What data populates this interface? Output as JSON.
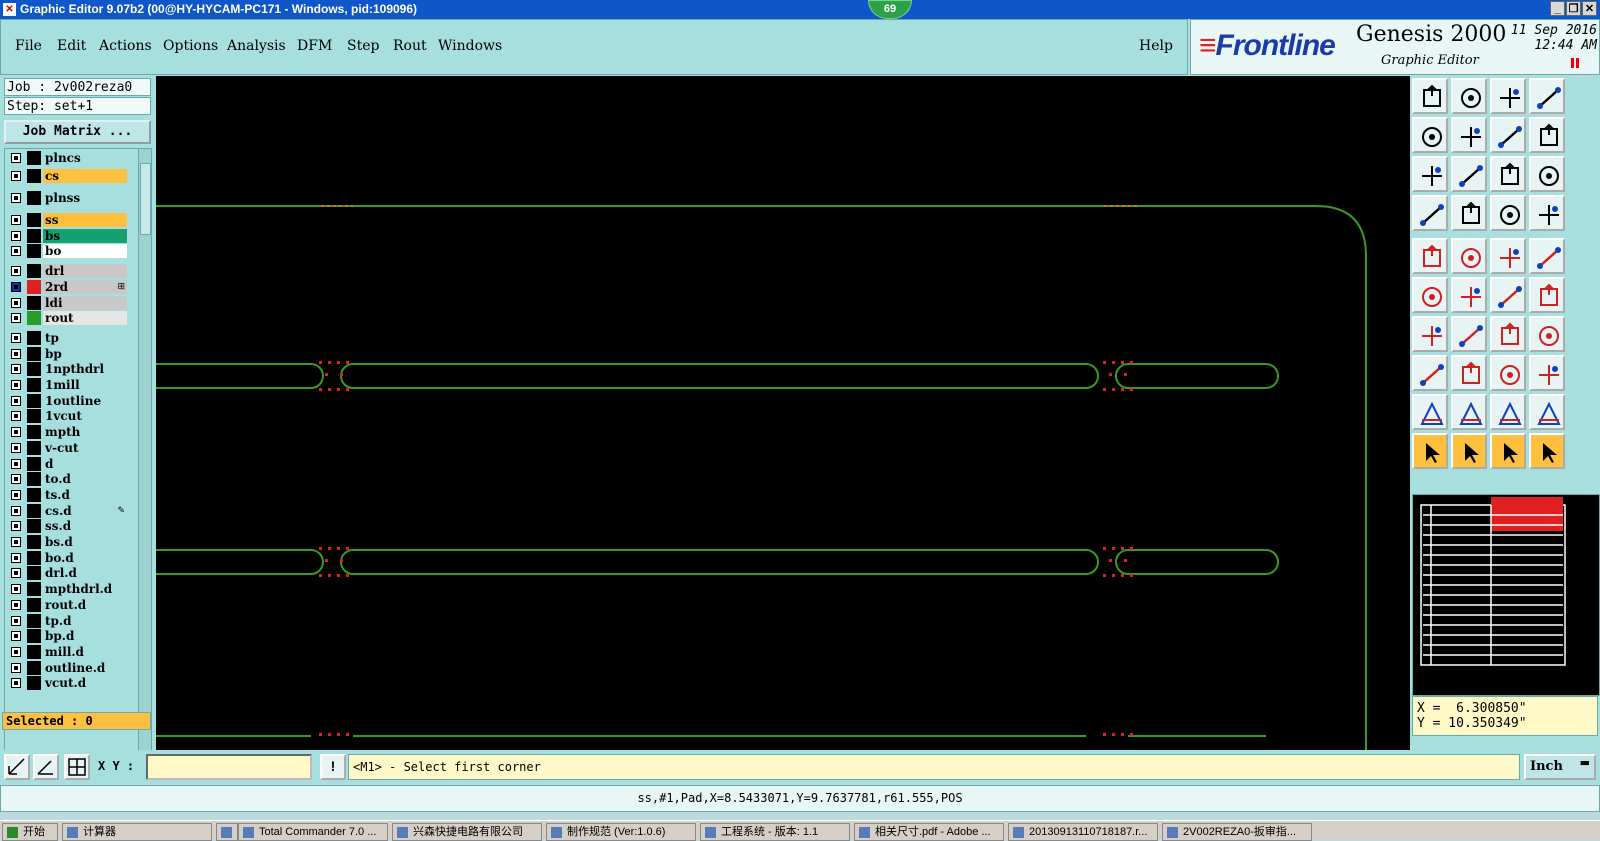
{
  "window": {
    "title": "Graphic Editor 9.07b2 (00@HY-HYCAM-PC171 - Windows, pid:109096)",
    "badge": "69",
    "min_glyph": "_",
    "max_glyph": "❐",
    "close_glyph": "✕"
  },
  "menu": [
    "File",
    "Edit",
    "Actions",
    "Options",
    "Analysis",
    "DFM",
    "Step",
    "Rout",
    "Windows"
  ],
  "help_label": "Help",
  "brand": {
    "logo": "Frontline",
    "title": "Genesis 2000",
    "subtitle": "Graphic Editor",
    "date": "11 Sep 2016",
    "time": "12:44 AM"
  },
  "job": {
    "job_line": "Job : 2v002reza0",
    "step_line": "Step: set+1",
    "matrix_button": "Job Matrix ..."
  },
  "layers": [
    {
      "name": "plncs",
      "color": "#a7dede",
      "swatch": "#000000"
    },
    {
      "name": "cs",
      "color": "#ffbf3f",
      "swatch": "#000000"
    },
    {
      "name": "plnss",
      "color": "#a7dede",
      "swatch": "#000000"
    },
    {
      "name": "ss",
      "color": "#ffbf3f",
      "swatch": "#000000"
    },
    {
      "name": "bs",
      "color": "#14a070",
      "swatch": "#000000"
    },
    {
      "name": "bo",
      "color": "#ffffff",
      "swatch": "#000000"
    },
    {
      "name": "drl",
      "color": "#c8c8c8",
      "swatch": "#000000"
    },
    {
      "name": "2rd",
      "color": "#c8c8c8",
      "swatch": "#e02020",
      "marker": "⊞",
      "selected": true
    },
    {
      "name": "ldi",
      "color": "#c8c8c8",
      "swatch": "#000000"
    },
    {
      "name": "rout",
      "color": "#e6e6e6",
      "swatch": "#2a9a2a"
    },
    {
      "name": "tp",
      "color": "#a7dede",
      "swatch": "#000000"
    },
    {
      "name": "bp",
      "color": "#a7dede",
      "swatch": "#000000"
    },
    {
      "name": "1npthdrl",
      "color": "#a7dede",
      "swatch": "#000000"
    },
    {
      "name": "1mill",
      "color": "#a7dede",
      "swatch": "#000000"
    },
    {
      "name": "1outline",
      "color": "#a7dede",
      "swatch": "#000000"
    },
    {
      "name": "1vcut",
      "color": "#a7dede",
      "swatch": "#000000"
    },
    {
      "name": "mpth",
      "color": "#a7dede",
      "swatch": "#000000"
    },
    {
      "name": "v-cut",
      "color": "#a7dede",
      "swatch": "#000000"
    },
    {
      "name": "d",
      "color": "#a7dede",
      "swatch": "#000000"
    },
    {
      "name": "to.d",
      "color": "#a7dede",
      "swatch": "#000000"
    },
    {
      "name": "ts.d",
      "color": "#a7dede",
      "swatch": "#000000"
    },
    {
      "name": "cs.d",
      "color": "#a7dede",
      "swatch": "#000000",
      "marker": "✎"
    },
    {
      "name": "ss.d",
      "color": "#a7dede",
      "swatch": "#000000"
    },
    {
      "name": "bs.d",
      "color": "#a7dede",
      "swatch": "#000000"
    },
    {
      "name": "bo.d",
      "color": "#a7dede",
      "swatch": "#000000"
    },
    {
      "name": "drl.d",
      "color": "#a7dede",
      "swatch": "#000000"
    },
    {
      "name": "mpthdrl.d",
      "color": "#a7dede",
      "swatch": "#000000"
    },
    {
      "name": "rout.d",
      "color": "#a7dede",
      "swatch": "#000000"
    },
    {
      "name": "tp.d",
      "color": "#a7dede",
      "swatch": "#000000"
    },
    {
      "name": "bp.d",
      "color": "#a7dede",
      "swatch": "#000000"
    },
    {
      "name": "mill.d",
      "color": "#a7dede",
      "swatch": "#000000"
    },
    {
      "name": "outline.d",
      "color": "#a7dede",
      "swatch": "#000000"
    },
    {
      "name": "vcut.d",
      "color": "#a7dede",
      "swatch": "#000000"
    }
  ],
  "selected_label": "Selected : 0",
  "coords": {
    "x": "X =  6.300850\"",
    "y": "Y = 10.350349\""
  },
  "xy_label": "X Y :",
  "xy_value": "",
  "excl_glyph": "!",
  "prompt": "<M1> - Select first corner",
  "units": "Inch",
  "units_arrow": "▬",
  "status": "ss,#1,Pad,X=8.5433071,Y=9.7637781,r61.555,POS",
  "taskbar": [
    {
      "label": "开始",
      "start": true
    },
    {
      "label": "计算器"
    },
    {
      "label": ""
    },
    {
      "label": "Total Commander 7.0 ..."
    },
    {
      "label": "兴森快捷电路有限公司"
    },
    {
      "label": "制作规范 (Ver:1.0.6)"
    },
    {
      "label": "工程系统 - 版本: 1.1"
    },
    {
      "label": "相关尺寸.pdf - Adobe ..."
    },
    {
      "label": "20130913110718187.r..."
    },
    {
      "label": "2V002REZA0-扳审指..."
    }
  ],
  "colors": {
    "panel": "#a7dede",
    "trace": "#3a9a1a",
    "pad_dot": "#e02020",
    "highlight": "#ffbf3f"
  }
}
